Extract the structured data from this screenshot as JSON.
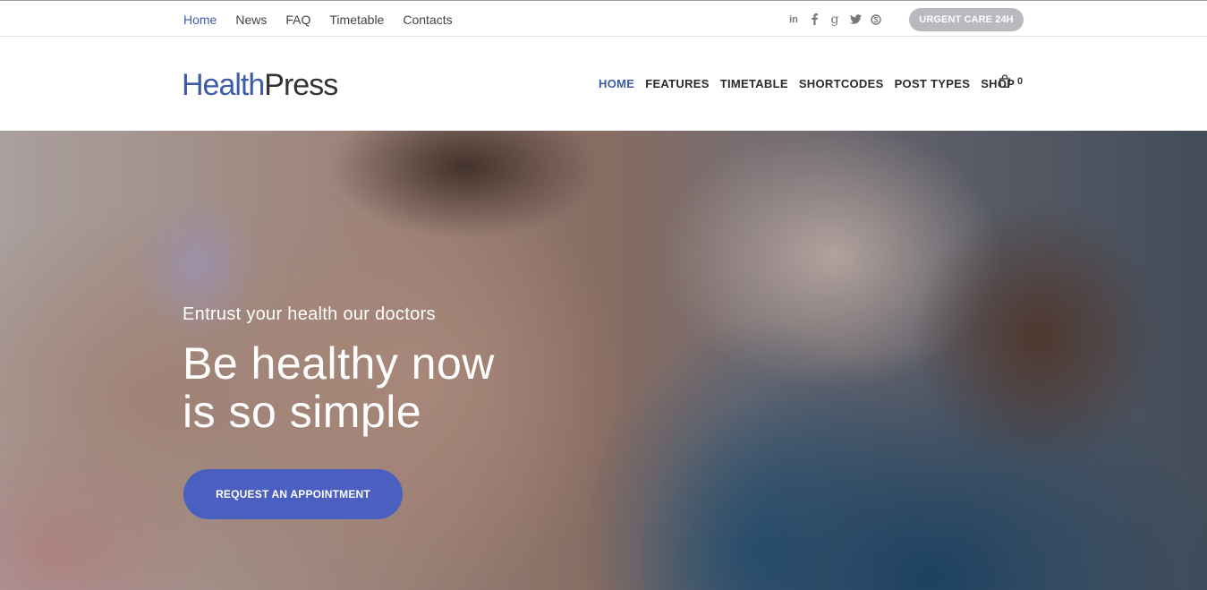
{
  "topbar": {
    "nav": [
      {
        "label": "Home",
        "active": true
      },
      {
        "label": "News",
        "active": false
      },
      {
        "label": "FAQ",
        "active": false
      },
      {
        "label": "Timetable",
        "active": false
      },
      {
        "label": "Contacts",
        "active": false
      }
    ],
    "social_icons": [
      {
        "icon": "linkedin-icon",
        "glyph": "in"
      },
      {
        "icon": "facebook-icon",
        "glyph": "f"
      },
      {
        "icon": "google-plus-icon",
        "glyph": "g"
      },
      {
        "icon": "twitter-icon",
        "glyph": "t"
      },
      {
        "icon": "skype-icon",
        "glyph": "s"
      }
    ],
    "urgent_label": "URGENT CARE 24H"
  },
  "header": {
    "logo_part1": "Health",
    "logo_part2": "Press",
    "nav": [
      {
        "label": "HOME",
        "active": true
      },
      {
        "label": "FEATURES",
        "active": false
      },
      {
        "label": "TIMETABLE",
        "active": false
      },
      {
        "label": "SHORTCODES",
        "active": false
      },
      {
        "label": "POST TYPES",
        "active": false
      },
      {
        "label": "SHOP",
        "active": false
      }
    ],
    "cart_count": "0"
  },
  "hero": {
    "subtitle": "Entrust your health our doctors",
    "title_line1": "Be healthy now",
    "title_line2": "is so simple",
    "cta_label": "REQUEST AN APPOINTMENT"
  },
  "colors": {
    "accent": "#3e5aa8",
    "cta": "#4a5fc0",
    "urgent": "#b8bac0"
  }
}
